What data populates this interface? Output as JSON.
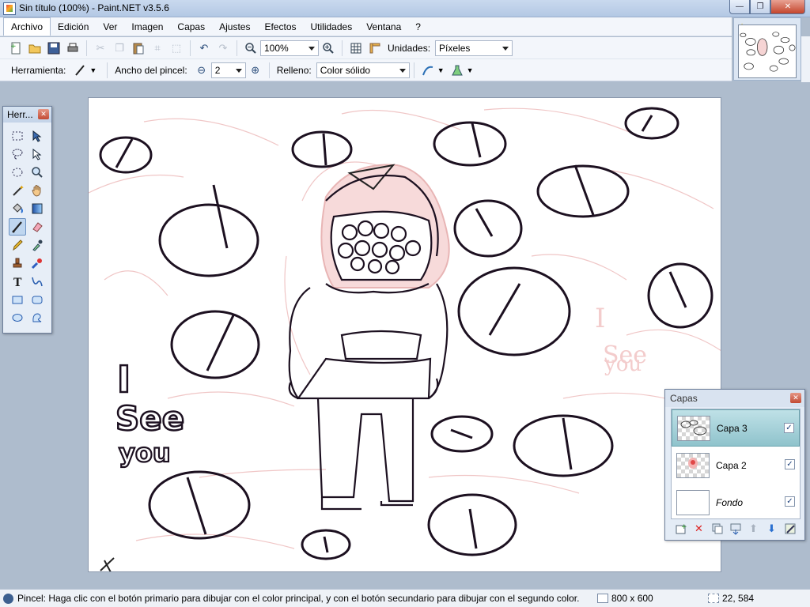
{
  "window": {
    "title": "Sin título (100%) - Paint.NET v3.5.6",
    "min_symbol": "—",
    "max_symbol": "❐",
    "close_symbol": "✕"
  },
  "menu": [
    {
      "label": "Archivo"
    },
    {
      "label": "Edición"
    },
    {
      "label": "Ver"
    },
    {
      "label": "Imagen"
    },
    {
      "label": "Capas"
    },
    {
      "label": "Ajustes"
    },
    {
      "label": "Efectos"
    },
    {
      "label": "Utilidades"
    },
    {
      "label": "Ventana"
    },
    {
      "label": "?"
    }
  ],
  "toolbar": {
    "zoom_value": "100%",
    "units_label": "Unidades:",
    "units_value": "Píxeles",
    "tool_label": "Herramienta:",
    "brush_width_label": "Ancho del pincel:",
    "brush_width_value": "2",
    "fill_label": "Relleno:",
    "fill_value": "Color sólido"
  },
  "tools_panel": {
    "title": "Herr...",
    "icons": [
      "rectangle-select-icon",
      "move-selection-icon",
      "lasso-select-icon",
      "move-selected-icon",
      "ellipse-select-icon",
      "zoom-icon",
      "magic-wand-icon",
      "pan-icon",
      "paint-bucket-icon",
      "gradient-icon",
      "paintbrush-icon",
      "eraser-icon",
      "pencil-icon",
      "color-picker-icon",
      "clone-stamp-icon",
      "recolor-icon",
      "text-icon",
      "line-curve-icon",
      "rectangle-icon",
      "rounded-rectangle-icon",
      "ellipse-icon",
      "freeform-shape-icon"
    ],
    "selected_icon": "paintbrush-icon"
  },
  "layers_panel": {
    "title": "Capas",
    "layers": [
      {
        "name": "Capa 3",
        "visible": true,
        "selected": true
      },
      {
        "name": "Capa 2",
        "visible": true,
        "selected": false
      },
      {
        "name": "Fondo",
        "visible": true,
        "selected": false
      }
    ]
  },
  "canvas": {
    "text_left": [
      "I",
      "See",
      "you"
    ],
    "text_right": [
      "I",
      "See",
      "you"
    ]
  },
  "status": {
    "hint": "Pincel: Haga clic con el botón primario para dibujar con el color principal, y con el botón secundario para dibujar con el segundo color.",
    "image_size": "800 x 600",
    "cursor_pos": "22, 584"
  },
  "colors": {
    "accent": "#8fc3cc",
    "workspace": "#aebccd",
    "sketch_line": "#1c1020",
    "sketch_pink": "#f0c6c6"
  }
}
